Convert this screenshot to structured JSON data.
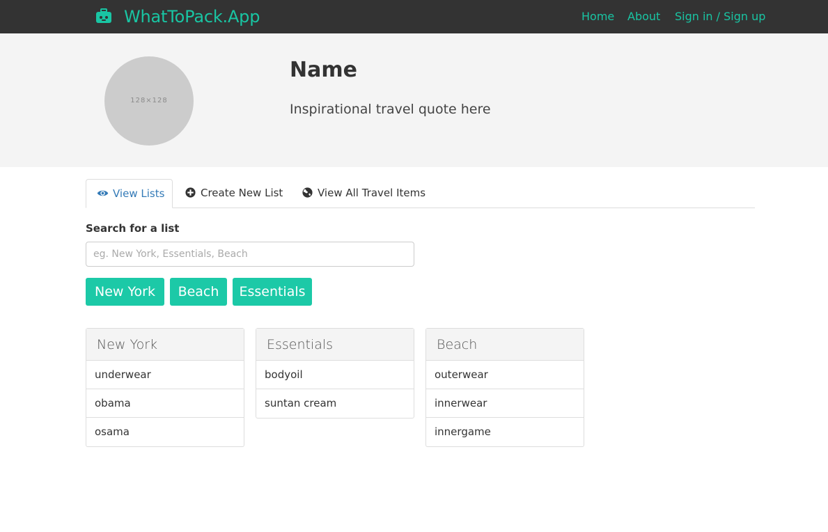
{
  "navbar": {
    "brand": "WhatToPack.App",
    "brand_icon": "suitcase-icon",
    "links": [
      "Home",
      "About",
      "Sign in / Sign up"
    ],
    "accent_color": "#19c5a3",
    "background": "#333333"
  },
  "profile": {
    "avatar_label": "128×128",
    "name": "Name",
    "quote": "Inspirational travel quote here"
  },
  "tabs": [
    {
      "label": "View Lists",
      "icon": "eye-icon",
      "active": true
    },
    {
      "label": "Create New List",
      "icon": "plus-circle-icon",
      "active": false
    },
    {
      "label": "View All Travel Items",
      "icon": "globe-icon",
      "active": false
    }
  ],
  "search": {
    "label": "Search for a list",
    "placeholder": "eg. New York, Essentials, Beach",
    "value": ""
  },
  "quick_filters": [
    "New York",
    "Beach",
    "Essentials"
  ],
  "lists": [
    {
      "title": "New York",
      "items": [
        "underwear",
        "obama",
        "osama"
      ]
    },
    {
      "title": "Essentials",
      "items": [
        "bodyoil",
        "suntan cream"
      ]
    },
    {
      "title": "Beach",
      "items": [
        "outerwear",
        "innerwear",
        "innergame"
      ]
    }
  ],
  "colors": {
    "accent": "#1cc9a7",
    "active_tab": "#337ab7"
  }
}
